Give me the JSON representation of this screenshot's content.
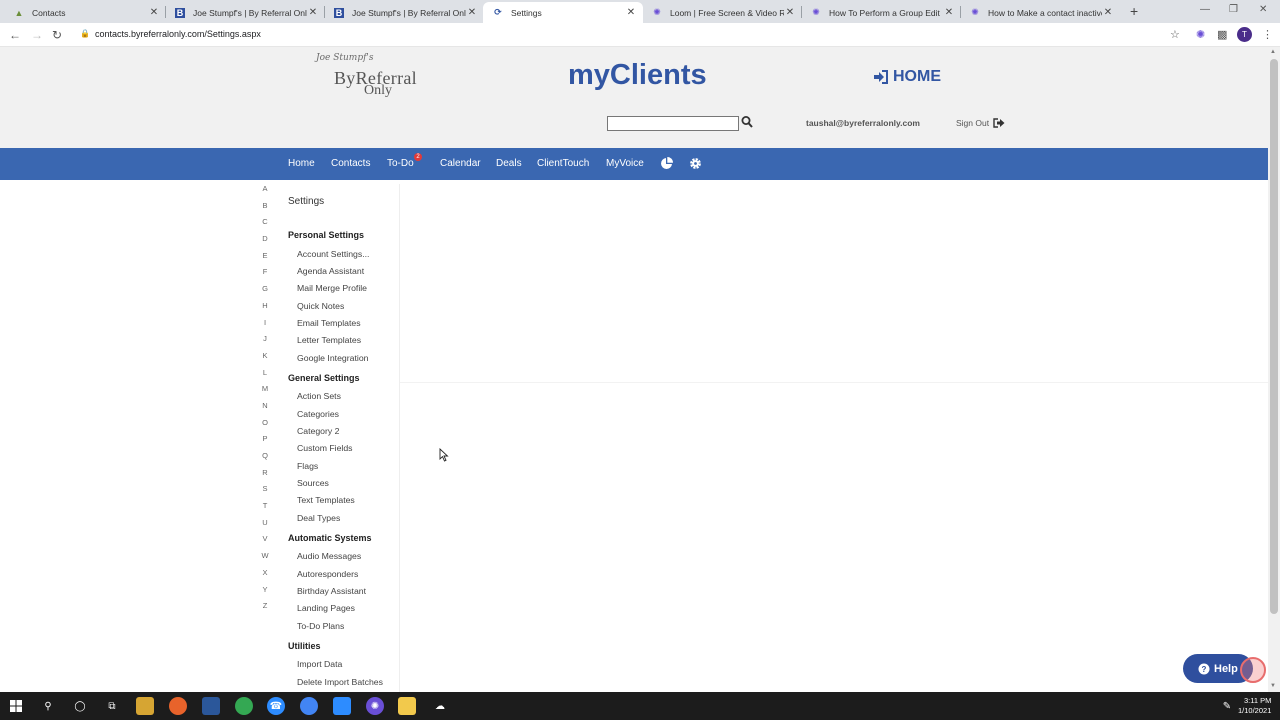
{
  "browser": {
    "tabs": [
      {
        "title": "Contacts",
        "icon": "contacts-favicon"
      },
      {
        "title": "Joe Stumpf's | By Referral Only",
        "icon": "bro-favicon"
      },
      {
        "title": "Joe Stumpf's | By Referral Only",
        "icon": "bro-favicon"
      },
      {
        "title": "Settings",
        "icon": "settings-favicon"
      },
      {
        "title": "Loom | Free Screen & Video Rec...",
        "icon": "loom-favicon"
      },
      {
        "title": "How To Perform a Group Edit",
        "icon": "loom-favicon"
      },
      {
        "title": "How to Make a contact inactive",
        "icon": "loom-favicon"
      }
    ],
    "url": "contacts.byreferralonly.com/Settings.aspx",
    "profile_initial": "T"
  },
  "header": {
    "logo_signature": "Joe Stumpf's",
    "logo_line1": "ByReferral",
    "logo_line2": "Only",
    "app_title": "myClients",
    "home_label": "HOME",
    "search_value": "",
    "user_email": "taushal@byreferralonly.com",
    "signout_label": "Sign Out"
  },
  "nav": {
    "items": [
      "Home",
      "Contacts",
      "To-Do",
      "Calendar",
      "Deals",
      "ClientTouch",
      "MyVoice"
    ],
    "todo_badge": "2"
  },
  "alphabet": [
    "A",
    "B",
    "C",
    "D",
    "E",
    "F",
    "G",
    "H",
    "I",
    "J",
    "K",
    "L",
    "M",
    "N",
    "O",
    "P",
    "Q",
    "R",
    "S",
    "T",
    "U",
    "V",
    "W",
    "X",
    "Y",
    "Z"
  ],
  "sidebar": {
    "title": "Settings",
    "sections": [
      {
        "heading": "Personal Settings",
        "items": [
          "Account Settings...",
          "Agenda Assistant",
          "Mail Merge Profile",
          "Quick Notes",
          "Email Templates",
          "Letter Templates",
          "Google Integration"
        ]
      },
      {
        "heading": "General Settings",
        "items": [
          "Action Sets",
          "Categories",
          "Category 2",
          "Custom Fields",
          "Flags",
          "Sources",
          "Text Templates",
          "Deal Types"
        ]
      },
      {
        "heading": "Automatic Systems",
        "items": [
          "Audio Messages",
          "Autoresponders",
          "Birthday Assistant",
          "Landing Pages",
          "To-Do Plans"
        ]
      },
      {
        "heading": "Utilities",
        "items": [
          "Import Data",
          "Delete Import Batches"
        ]
      }
    ]
  },
  "help": {
    "label": "Help"
  },
  "taskbar": {
    "time": "3:11 PM",
    "date": "1/10/2021"
  },
  "colors": {
    "brand_blue": "#3256a3",
    "navbar": "#3a67b1",
    "header_bg": "#f1f1f1"
  }
}
